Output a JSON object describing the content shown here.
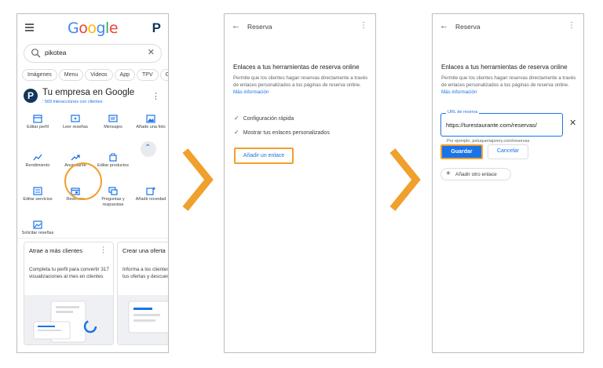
{
  "panel1": {
    "logo": "Google",
    "logo_letters": [
      {
        "ch": "G",
        "color": "#4285F4"
      },
      {
        "ch": "o",
        "color": "#EA4335"
      },
      {
        "ch": "o",
        "color": "#FBBC05"
      },
      {
        "ch": "g",
        "color": "#4285F4"
      },
      {
        "ch": "l",
        "color": "#34A853"
      },
      {
        "ch": "e",
        "color": "#EA4335"
      }
    ],
    "avatar_letter": "P",
    "search_query": "pikotea",
    "chips": [
      "Imágenes",
      "Menu",
      "Videos",
      "App",
      "TPV",
      "Go"
    ],
    "business": {
      "logo_letter": "P",
      "title": "Tu empresa en Google",
      "subtitle": "569 interacciones con clientes"
    },
    "actions": [
      {
        "label": "Editar perfil",
        "icon": "storefront-icon"
      },
      {
        "label": "Leer reseñas",
        "icon": "reviews-icon"
      },
      {
        "label": "Mensajes",
        "icon": "messages-icon"
      },
      {
        "label": "Añade una foto",
        "icon": "photo-icon"
      },
      {
        "label": "Rendimiento",
        "icon": "performance-icon"
      },
      {
        "label": "Anunciarse",
        "icon": "trending-icon"
      },
      {
        "label": "Editar productos",
        "icon": "shopping-bag-icon"
      },
      {
        "label": "Editar servicios",
        "icon": "services-list-icon"
      },
      {
        "label": "Reservas",
        "icon": "calendar-icon"
      },
      {
        "label": "Preguntas y respuestas",
        "icon": "qa-icon"
      },
      {
        "label": "Añadir novedad",
        "icon": "post-add-icon"
      },
      {
        "label": "Solicitar reseñas",
        "icon": "request-review-icon"
      }
    ],
    "cards": [
      {
        "title": "Atrae a más clientes",
        "body": "Completa tu perfil para convertir 317 visualizaciones al mes en clientes"
      },
      {
        "title": "Crear una oferta",
        "body": "Informa a los clientes de tus ofertas y descuentos"
      }
    ]
  },
  "panel2": {
    "title": "Reserva",
    "section_title": "Enlaces a tus herramientas de reserva online",
    "section_desc": "Permite que los clientes hagan reservas directamente a través de enlaces personalizados a tus páginas de reserva online.",
    "more_info": "Más información",
    "checks": [
      "Configuración rápida",
      "Mostrar tus enlaces personalizados"
    ],
    "add_link": "Añadir un enlace"
  },
  "panel3": {
    "title": "Reserva",
    "section_title": "Enlaces a tus herramientas de reserva online",
    "section_desc": "Permite que los clientes hagan reservas directamente a través de enlaces personalizados a tus páginas de reserva online.",
    "more_info": "Más información",
    "url_label": "URL de reserva",
    "url_value": "https://turestaurante.com/reservas/",
    "url_hint": "Por ejemplo, peluqueriajonny.com/reservas",
    "save": "Guardar",
    "cancel": "Cancelar",
    "add_other": "Añadir otro enlace"
  },
  "colors": {
    "highlight": "#f0a02c",
    "link_blue": "#1a73e8",
    "check_green": "#188038",
    "brand_navy": "#12355b"
  }
}
